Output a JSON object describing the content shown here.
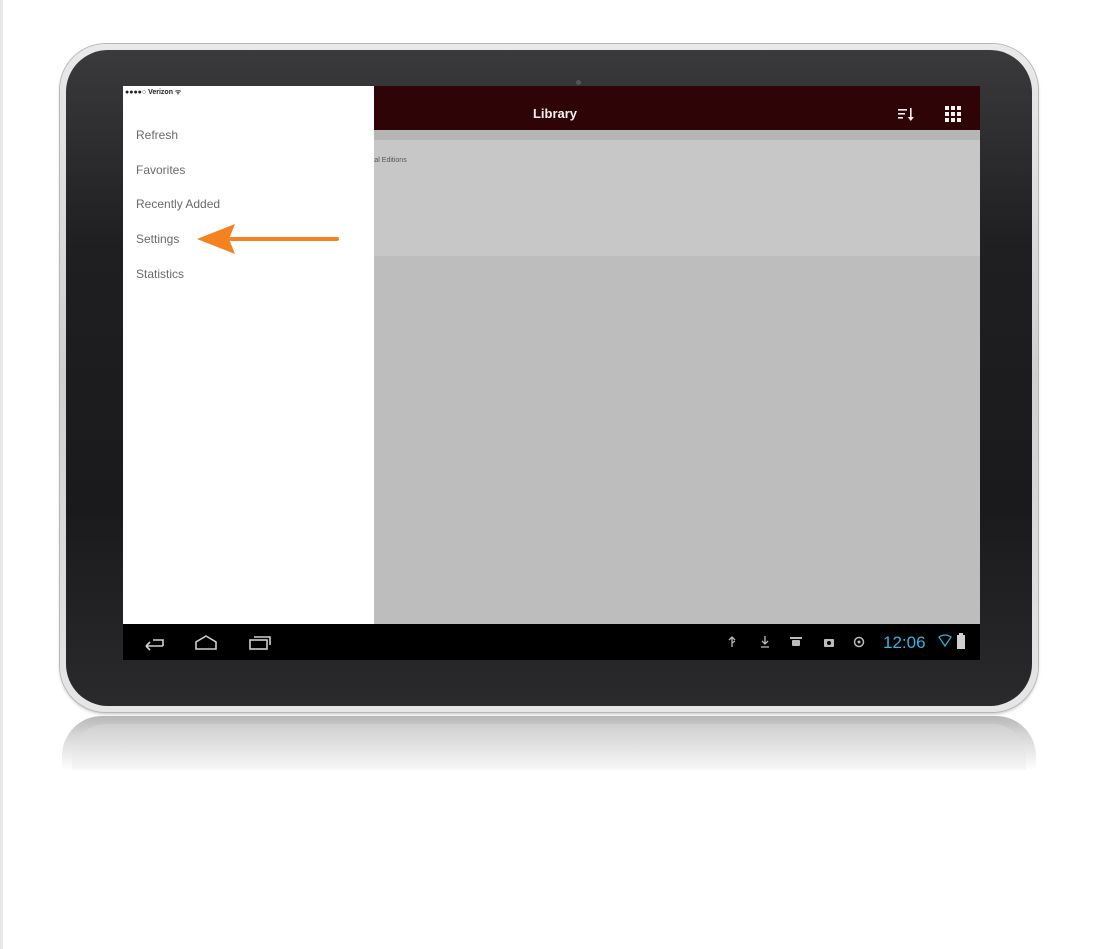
{
  "status_bar": {
    "carrier": "●●●●○ Verizon ᯤ"
  },
  "app_bar": {
    "title": "Library"
  },
  "content": {
    "section_label": "gital Editions"
  },
  "drawer": {
    "items": [
      {
        "label": "Refresh"
      },
      {
        "label": "Favorites"
      },
      {
        "label": "Recently Added"
      },
      {
        "label": "Settings"
      },
      {
        "label": "Statistics"
      }
    ]
  },
  "system_bar": {
    "time": "12:06"
  },
  "colors": {
    "app_bar": "#2e0406",
    "clock": "#33b5e5",
    "arrow": "#f58220",
    "drawer_bg": "#ffffff",
    "content_bg": "#bdbdbd"
  },
  "icons": [
    "sort-icon",
    "grid-view-icon",
    "back-icon",
    "home-icon",
    "recent-apps-icon",
    "usb-icon",
    "download-icon",
    "android-debug-icon",
    "screenshot-icon",
    "sync-icon",
    "wifi-icon",
    "battery-icon"
  ]
}
